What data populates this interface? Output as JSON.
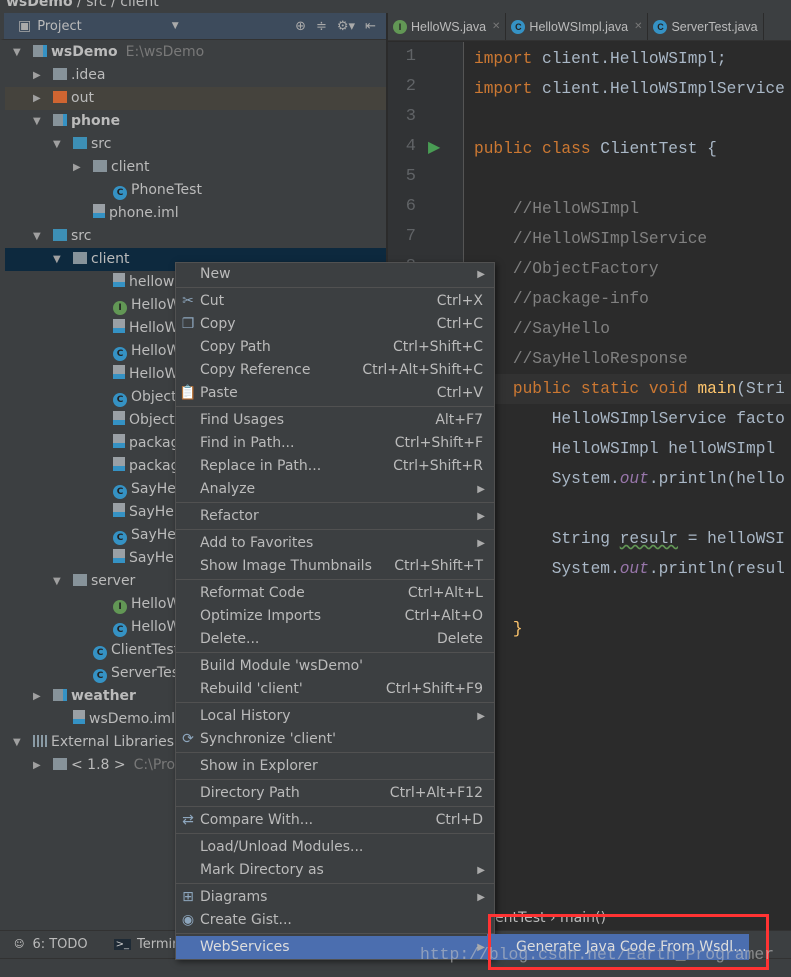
{
  "breadcrumb": [
    "wsDemo",
    "src",
    "client"
  ],
  "project_panel": {
    "title": "Project"
  },
  "tree": [
    {
      "label": "wsDemo",
      "extra": "E:\\wsDemo",
      "level": 0,
      "arrow": "down",
      "icon": "module",
      "bold": true
    },
    {
      "label": ".idea",
      "level": 1,
      "arrow": "right",
      "icon": "folder"
    },
    {
      "label": "out",
      "level": 1,
      "arrow": "right",
      "icon": "folder-orange",
      "highlight": true
    },
    {
      "label": "phone",
      "level": 1,
      "arrow": "down",
      "icon": "module",
      "bold": true
    },
    {
      "label": "src",
      "level": 2,
      "arrow": "down",
      "icon": "folder-blue"
    },
    {
      "label": "client",
      "level": 3,
      "arrow": "right",
      "icon": "package"
    },
    {
      "label": "PhoneTest",
      "level": 4,
      "icon": "class"
    },
    {
      "label": "phone.iml",
      "level": 3,
      "icon": "file"
    },
    {
      "label": "src",
      "level": 1,
      "arrow": "down",
      "icon": "folder-blue"
    },
    {
      "label": "client",
      "level": 2,
      "arrow": "down",
      "icon": "package",
      "selected": true
    },
    {
      "label": "hellows.wsdl",
      "level": 4,
      "icon": "file"
    },
    {
      "label": "HelloWSImpl",
      "level": 4,
      "icon": "interface"
    },
    {
      "label": "HelloWSImpl",
      "level": 4,
      "icon": "file"
    },
    {
      "label": "HelloWSImplService",
      "level": 4,
      "icon": "class"
    },
    {
      "label": "HelloWSImplService",
      "level": 4,
      "icon": "file"
    },
    {
      "label": "ObjectFactory",
      "level": 4,
      "icon": "class"
    },
    {
      "label": "ObjectFactory",
      "level": 4,
      "icon": "file"
    },
    {
      "label": "package-info",
      "level": 4,
      "icon": "file"
    },
    {
      "label": "package-info",
      "level": 4,
      "icon": "file"
    },
    {
      "label": "SayHello",
      "level": 4,
      "icon": "class"
    },
    {
      "label": "SayHello.class",
      "level": 4,
      "icon": "file"
    },
    {
      "label": "SayHelloResponse",
      "level": 4,
      "icon": "class"
    },
    {
      "label": "SayHelloResponse",
      "level": 4,
      "icon": "file"
    },
    {
      "label": "server",
      "level": 2,
      "arrow": "down",
      "icon": "package"
    },
    {
      "label": "HelloWS",
      "level": 4,
      "icon": "interface"
    },
    {
      "label": "HelloWSImpl",
      "level": 4,
      "icon": "class"
    },
    {
      "label": "ClientTest",
      "level": 3,
      "icon": "class"
    },
    {
      "label": "ServerTest",
      "level": 3,
      "icon": "class"
    },
    {
      "label": "weather",
      "level": 1,
      "arrow": "right",
      "icon": "module",
      "bold": true
    },
    {
      "label": "wsDemo.iml",
      "level": 2,
      "icon": "file"
    },
    {
      "label": "External Libraries",
      "level": 0,
      "arrow": "down",
      "icon": "library"
    },
    {
      "label": "< 1.8 >",
      "extra": "C:\\Program",
      "level": 1,
      "arrow": "right",
      "icon": "folder"
    }
  ],
  "tabs": [
    {
      "label": "HelloWS.java",
      "icon": "interface"
    },
    {
      "label": "HelloWSImpl.java",
      "icon": "class"
    },
    {
      "label": "ServerTest.java",
      "icon": "class"
    }
  ],
  "line_numbers": [
    "1",
    "2",
    "3",
    "4",
    "5",
    "6",
    "7",
    "8"
  ],
  "code": [
    [
      [
        "import ",
        "kw"
      ],
      [
        "client.HelloWSImpl;",
        ""
      ]
    ],
    [
      [
        "import ",
        "kw"
      ],
      [
        "client.HelloWSImplService",
        ""
      ]
    ],
    [],
    [
      [
        "public class ",
        "kw"
      ],
      [
        "ClientTest {",
        ""
      ]
    ],
    [],
    [
      [
        "    //HelloWSImpl",
        "cm"
      ]
    ],
    [
      [
        "    //HelloWSImplService",
        "cm"
      ]
    ],
    [
      [
        "    //ObjectFactory",
        "cm"
      ]
    ],
    [
      [
        "    //package-info",
        "cm"
      ]
    ],
    [
      [
        "    //SayHello",
        "cm"
      ]
    ],
    [
      [
        "    //SayHelloResponse",
        "cm"
      ]
    ],
    [
      [
        "    public static void ",
        "kw"
      ],
      [
        "main",
        "fn"
      ],
      [
        "(Stri",
        ""
      ]
    ],
    [
      [
        "        HelloWSImplService facto",
        ""
      ]
    ],
    [
      [
        "        HelloWSImpl helloWSImpl ",
        ""
      ]
    ],
    [
      [
        "        System.",
        ""
      ],
      [
        "out",
        "st"
      ],
      [
        ".println(hello",
        ""
      ]
    ],
    [],
    [
      [
        "        String ",
        ""
      ],
      [
        "resulr",
        "wv"
      ],
      [
        " = helloWSI",
        ""
      ]
    ],
    [
      [
        "        System.",
        ""
      ],
      [
        "out",
        "st"
      ],
      [
        ".println(resul",
        ""
      ]
    ],
    [],
    [
      [
        "    }",
        "fn"
      ]
    ]
  ],
  "editor_breadcrumb": "entTest  ›  main()",
  "context_menu": [
    {
      "label": "New",
      "submenu": true
    },
    {
      "sep": true
    },
    {
      "label": "Cut",
      "shortcut": "Ctrl+X",
      "icon": "✂"
    },
    {
      "label": "Copy",
      "shortcut": "Ctrl+C",
      "icon": "❐"
    },
    {
      "label": "Copy Path",
      "shortcut": "Ctrl+Shift+C"
    },
    {
      "label": "Copy Reference",
      "shortcut": "Ctrl+Alt+Shift+C"
    },
    {
      "label": "Paste",
      "shortcut": "Ctrl+V",
      "icon": "📋"
    },
    {
      "sep": true
    },
    {
      "label": "Find Usages",
      "shortcut": "Alt+F7"
    },
    {
      "label": "Find in Path...",
      "shortcut": "Ctrl+Shift+F"
    },
    {
      "label": "Replace in Path...",
      "shortcut": "Ctrl+Shift+R"
    },
    {
      "label": "Analyze",
      "submenu": true
    },
    {
      "sep": true
    },
    {
      "label": "Refactor",
      "submenu": true
    },
    {
      "sep": true
    },
    {
      "label": "Add to Favorites",
      "submenu": true
    },
    {
      "label": "Show Image Thumbnails",
      "shortcut": "Ctrl+Shift+T"
    },
    {
      "sep": true
    },
    {
      "label": "Reformat Code",
      "shortcut": "Ctrl+Alt+L"
    },
    {
      "label": "Optimize Imports",
      "shortcut": "Ctrl+Alt+O"
    },
    {
      "label": "Delete...",
      "shortcut": "Delete"
    },
    {
      "sep": true
    },
    {
      "label": "Build Module 'wsDemo'"
    },
    {
      "label": "Rebuild 'client'",
      "shortcut": "Ctrl+Shift+F9"
    },
    {
      "sep": true
    },
    {
      "label": "Local History",
      "submenu": true
    },
    {
      "label": "Synchronize 'client'",
      "icon": "⟳"
    },
    {
      "sep": true
    },
    {
      "label": "Show in Explorer"
    },
    {
      "sep": true
    },
    {
      "label": "Directory Path",
      "shortcut": "Ctrl+Alt+F12"
    },
    {
      "sep": true
    },
    {
      "label": "Compare With...",
      "shortcut": "Ctrl+D",
      "icon": "⇄"
    },
    {
      "sep": true
    },
    {
      "label": "Load/Unload Modules..."
    },
    {
      "label": "Mark Directory as",
      "submenu": true
    },
    {
      "sep": true
    },
    {
      "label": "Diagrams",
      "submenu": true,
      "icon": "⊞"
    },
    {
      "label": "Create Gist...",
      "icon": "◉"
    },
    {
      "sep": true
    },
    {
      "label": "WebServices",
      "submenu": true,
      "active": true
    }
  ],
  "submenu_item": "Generate Java Code From Wsdl...",
  "bottom_tools": [
    {
      "label": "6: TODO",
      "icon": "todo-icon"
    },
    {
      "label": "Terminal",
      "icon": "terminal-icon"
    }
  ],
  "watermark": "http://blog.csdn.net/Earth_Programer",
  "colors": {
    "selection": "#0d293e",
    "menu_active": "#4b6eaf",
    "highlight_box": "#ff3333",
    "keyword": "#cc7832"
  }
}
